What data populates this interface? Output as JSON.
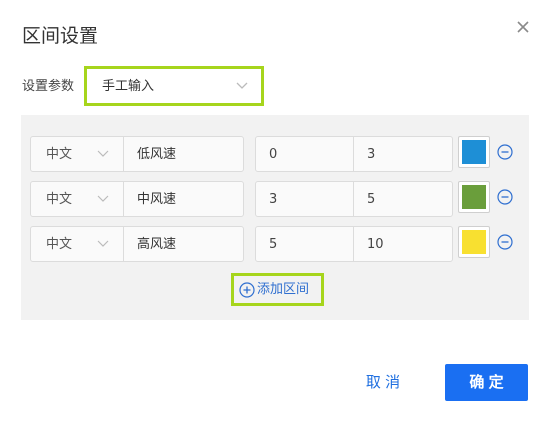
{
  "dialog": {
    "title": "区间设置",
    "close_icon": "close-icon"
  },
  "param": {
    "label": "设置参数",
    "selected": "手工输入"
  },
  "rows": [
    {
      "lang": "中文",
      "name": "低风速",
      "min": "0",
      "max": "3",
      "color": "#1e8fd6"
    },
    {
      "lang": "中文",
      "name": "中风速",
      "min": "3",
      "max": "5",
      "color": "#6a9e3b"
    },
    {
      "lang": "中文",
      "name": "高风速",
      "min": "5",
      "max": "10",
      "color": "#f8e030"
    }
  ],
  "add_label": "添加区间",
  "footer": {
    "cancel": "取 消",
    "ok": "确 定"
  },
  "colors": {
    "accent": "#1a6ff2",
    "highlight": "#a6d51c",
    "panel": "#f2f2f2"
  }
}
